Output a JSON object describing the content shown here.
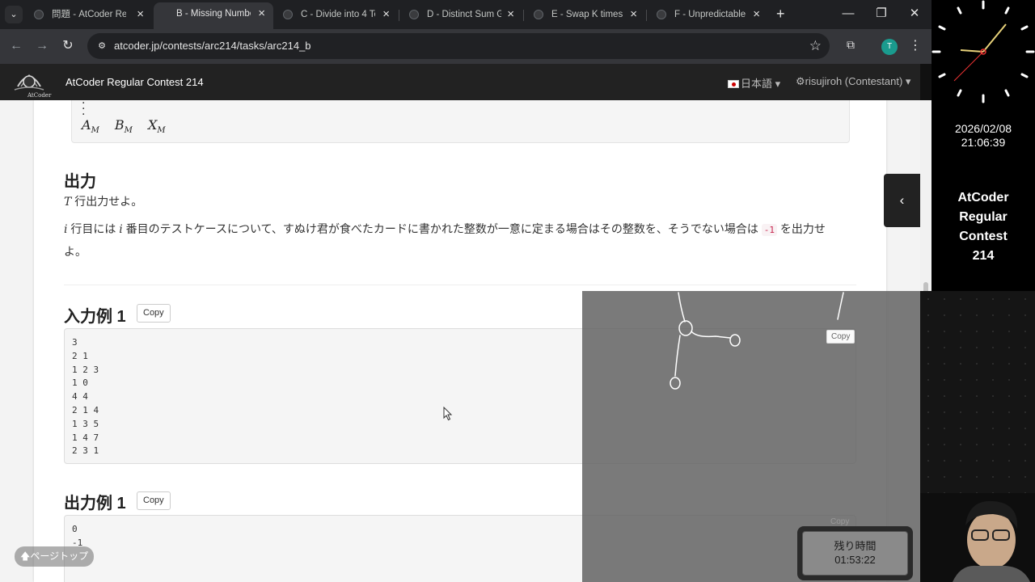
{
  "browser": {
    "tabs": [
      {
        "label": "問題 - AtCoder Re",
        "active": false
      },
      {
        "label": "B - Missing Numbe",
        "active": true
      },
      {
        "label": "C - Divide into 4 Te",
        "active": false
      },
      {
        "label": "D - Distinct Sum G",
        "active": false
      },
      {
        "label": "E - Swap K times",
        "active": false
      },
      {
        "label": "F - Unpredictable I",
        "active": false
      }
    ],
    "url": "atcoder.jp/contests/arc214/tasks/arc214_b",
    "profile_initial": "T"
  },
  "site": {
    "logo_text": "AtCoder",
    "contest_title": "AtCoder Regular Contest 214",
    "language": "日本語",
    "user": "risujiroh (Contestant)"
  },
  "format_box": {
    "last_line": {
      "a": "A",
      "b": "B",
      "x": "X",
      "sub": "M"
    }
  },
  "output_section": {
    "heading": "出力",
    "line1_var": "T",
    "line1_text": " 行出力せよ。",
    "line2_var1": "i",
    "line2_mid1": " 行目には ",
    "line2_var2": "i",
    "line2_mid2": " 番目のテストケースについて、すぬけ君が食べたカードに書かれた整数が一意に定まる場合はその整数を、そうでない場合は ",
    "line2_code": "-1",
    "line2_end1": " を出力せ",
    "line2_end2": "よ。"
  },
  "sample_input_1": {
    "heading": "入力例 1",
    "copy_label": "Copy",
    "lines": [
      "3",
      "2 1",
      "1 2 3",
      "1 0",
      "4 4",
      "2 1 4",
      "1 3 5",
      "1 4 7",
      "2 3 1"
    ]
  },
  "sample_output_1": {
    "heading": "出力例 1",
    "copy_label": "Copy",
    "lines": [
      "0",
      "-1"
    ]
  },
  "page_top_label": "ページトップ",
  "overlay": {
    "timer_label": "残り時間",
    "timer_value": "01:53:22",
    "date": "2026/02/08",
    "time": "21:06:39",
    "side_title": [
      "AtCoder",
      "Regular",
      "Contest",
      "214"
    ]
  }
}
